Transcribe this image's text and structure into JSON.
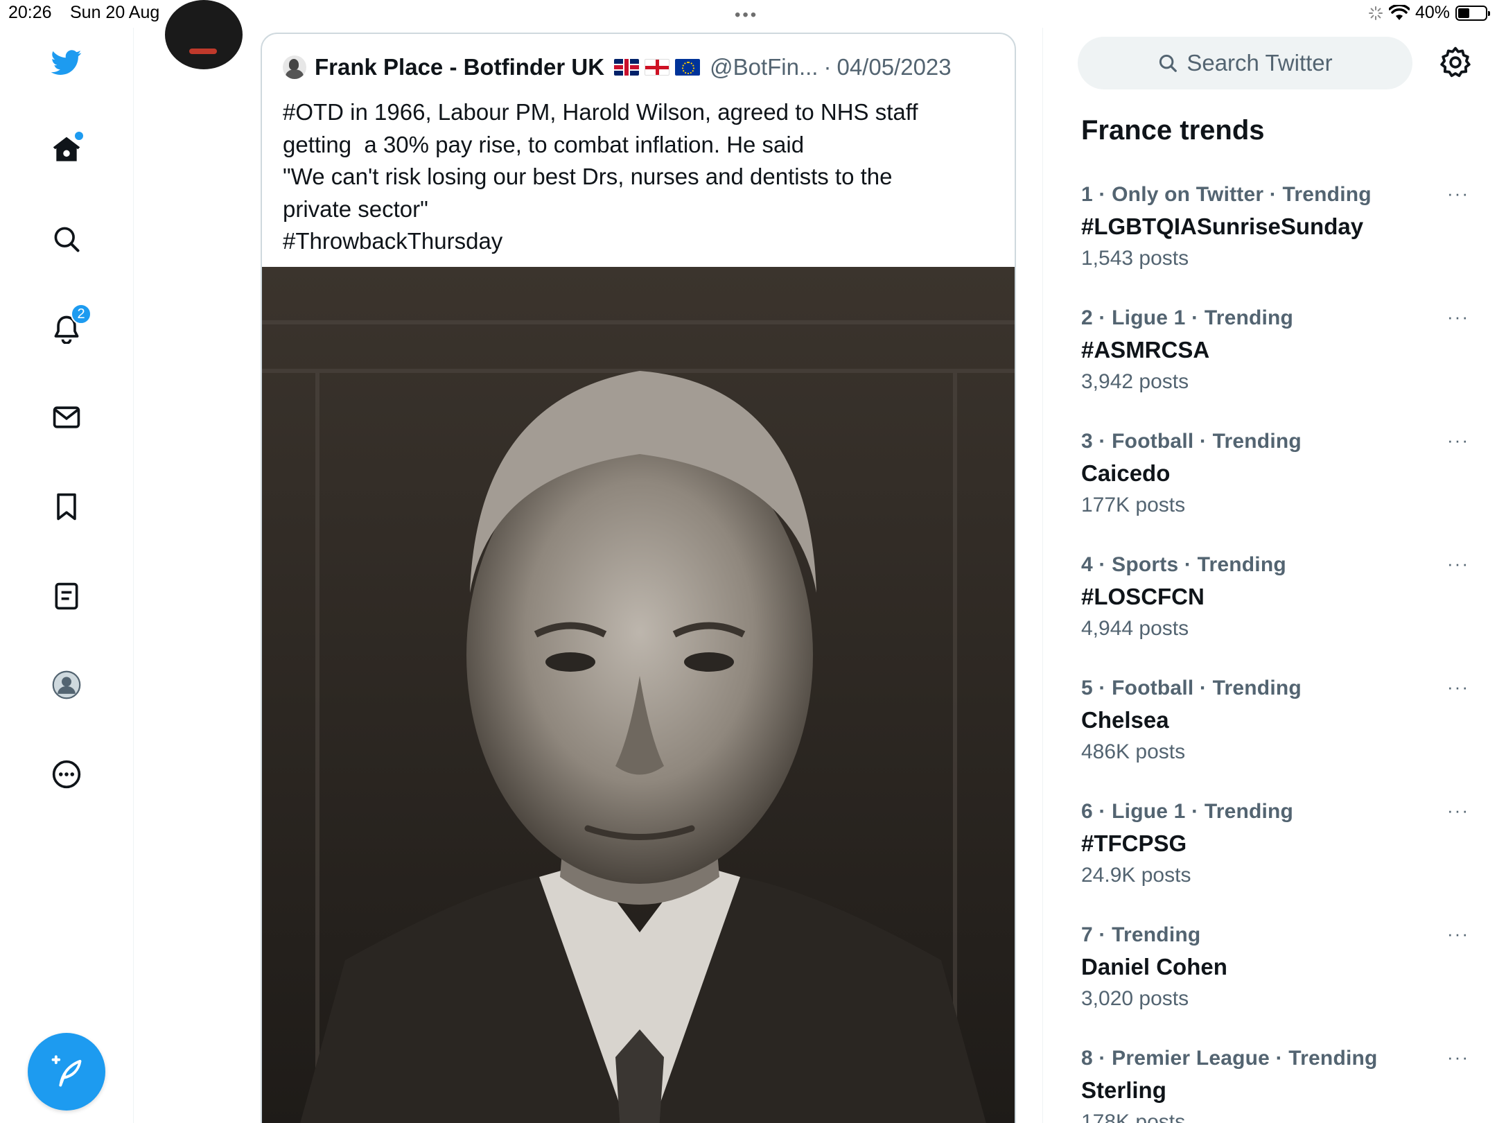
{
  "status_bar": {
    "time": "20:26",
    "date": "Sun 20 Aug",
    "battery": "40%"
  },
  "nav": {
    "notifications_badge": "2",
    "icons": [
      "twitter-logo-icon",
      "home-icon",
      "search-icon",
      "bell-icon",
      "mail-icon",
      "bookmark-icon",
      "lists-icon",
      "profile-icon",
      "more-icon",
      "compose-icon"
    ],
    "accent_color": "#1d9bf0"
  },
  "quoted_tweet": {
    "author_name": "Frank Place - Botfinder UK",
    "handle": "@BotFin...",
    "separator": "·",
    "date": "04/05/2023",
    "text_lines": [
      "#OTD in 1966, Labour PM, Harold Wilson, agreed to NHS staff",
      "getting  a 30% pay rise, to combat inflation. He said",
      "\"We can't risk losing our best Drs, nurses and dentists to the",
      "private sector\"",
      "#ThrowbackThursday"
    ]
  },
  "search": {
    "placeholder": "Search Twitter"
  },
  "trends": {
    "title": "France trends",
    "items": [
      {
        "meta": "1 · Only on Twitter · Trending",
        "name": "#LGBTQIASunriseSunday",
        "count": "1,543 posts"
      },
      {
        "meta": "2 · Ligue 1 · Trending",
        "name": "#ASMRCSA",
        "count": "3,942 posts"
      },
      {
        "meta": "3 · Football · Trending",
        "name": "Caicedo",
        "count": "177K posts"
      },
      {
        "meta": "4 · Sports · Trending",
        "name": "#LOSCFCN",
        "count": "4,944 posts"
      },
      {
        "meta": "5 · Football · Trending",
        "name": "Chelsea",
        "count": "486K posts"
      },
      {
        "meta": "6 · Ligue 1 · Trending",
        "name": "#TFCPSG",
        "count": "24.9K posts"
      },
      {
        "meta": "7 · Trending",
        "name": "Daniel Cohen",
        "count": "3,020 posts"
      },
      {
        "meta": "8 · Premier League · Trending",
        "name": "Sterling",
        "count": "178K posts"
      }
    ],
    "more_glyph": "···"
  }
}
